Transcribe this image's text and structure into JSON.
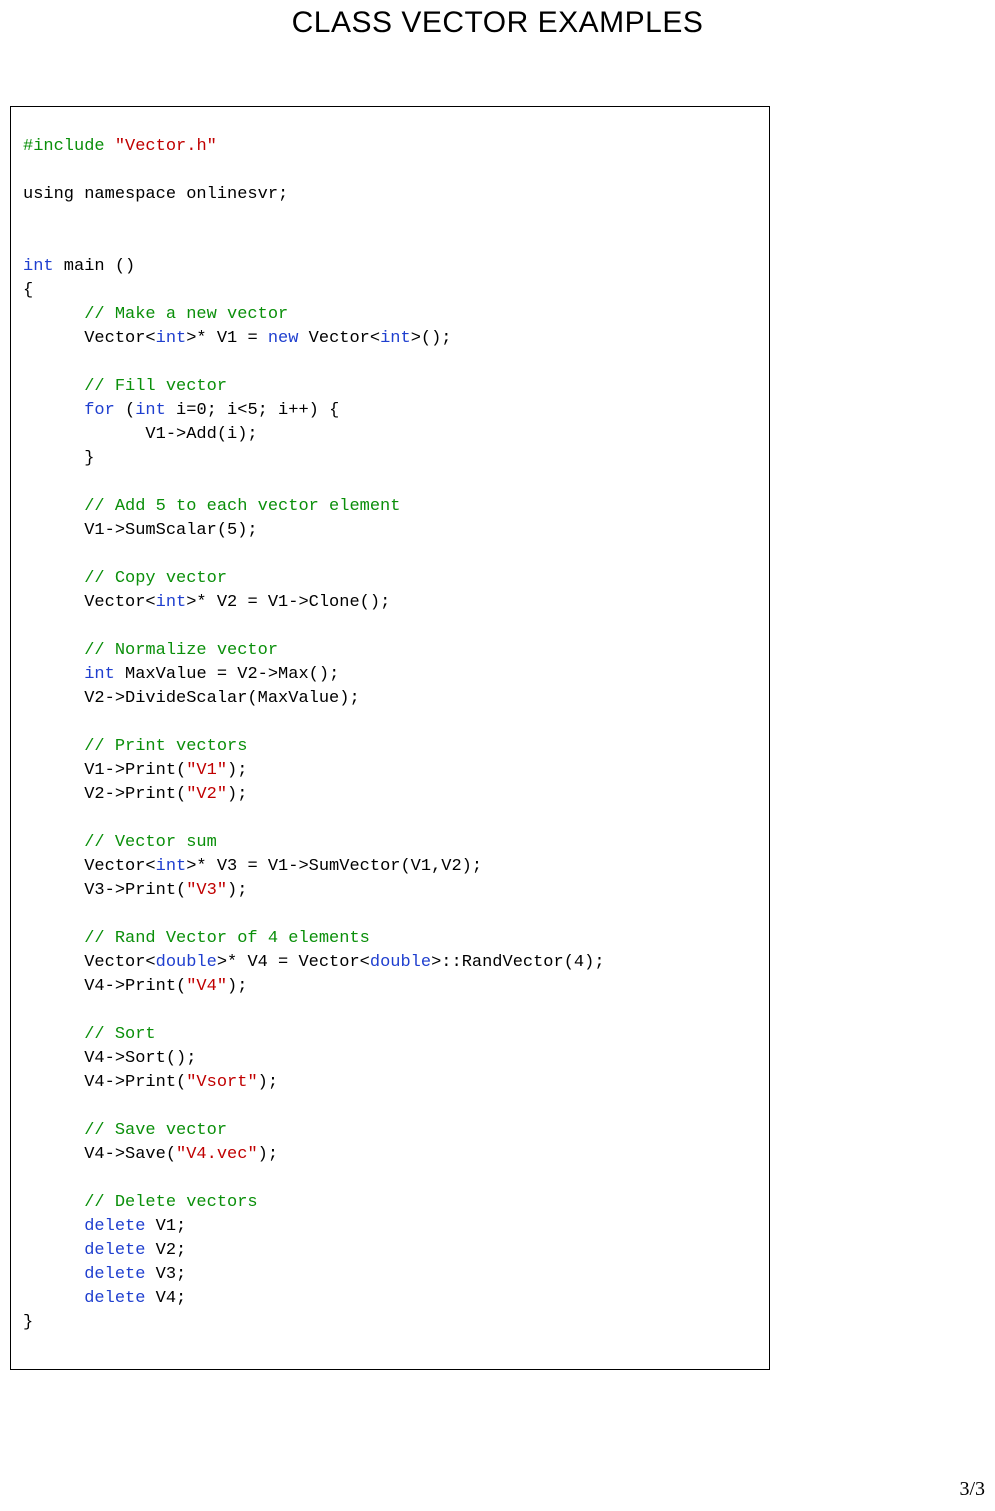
{
  "title": "CLASS VECTOR EXAMPLES",
  "page_number": "3/3",
  "code": {
    "line01_a": "#include",
    "line01_b": "\"Vector.h\"",
    "line02_blank": "",
    "line03": "using namespace onlinesvr;",
    "line04_blank": "",
    "line05_blank": "",
    "line06_a": "int",
    "line06_b": " main ()",
    "line07": "{",
    "line08_cmt": "      // Make a new vector",
    "line09_a": "      Vector<",
    "line09_b": "int",
    "line09_c": ">* V1 = ",
    "line09_d": "new",
    "line09_e": " Vector<",
    "line09_f": "int",
    "line09_g": ">();",
    "line10_blank": "",
    "line11_cmt": "      // Fill vector",
    "line12_a": "      ",
    "line12_b": "for",
    "line12_c": " (",
    "line12_d": "int",
    "line12_e": " i=0; i<5; i++) {",
    "line13": "            V1->Add(i);",
    "line14": "      }",
    "line15_blank": "",
    "line16_cmt": "      // Add 5 to each vector element",
    "line17": "      V1->SumScalar(5);",
    "line18_blank": "",
    "line19_cmt": "      // Copy vector",
    "line20_a": "      Vector<",
    "line20_b": "int",
    "line20_c": ">* V2 = V1->Clone();",
    "line21_blank": "",
    "line22_cmt": "      // Normalize vector",
    "line23_a": "      ",
    "line23_b": "int",
    "line23_c": " MaxValue = V2->Max();",
    "line24": "      V2->DivideScalar(MaxValue);",
    "line25_blank": "",
    "line26_cmt": "      // Print vectors",
    "line27_a": "      V1->Print(",
    "line27_b": "\"V1\"",
    "line27_c": ");",
    "line28_a": "      V2->Print(",
    "line28_b": "\"V2\"",
    "line28_c": ");",
    "line29_blank": "",
    "line30_cmt": "      // Vector sum",
    "line31_a": "      Vector<",
    "line31_b": "int",
    "line31_c": ">* V3 = V1->SumVector(V1,V2);",
    "line32_a": "      V3->Print(",
    "line32_b": "\"V3\"",
    "line32_c": ");",
    "line33_blank": "",
    "line34_cmt": "      // Rand Vector of 4 elements",
    "line35_a": "      Vector<",
    "line35_b": "double",
    "line35_c": ">* V4 = Vector<",
    "line35_d": "double",
    "line35_e": ">::RandVector(4);",
    "line36_a": "      V4->Print(",
    "line36_b": "\"V4\"",
    "line36_c": ");",
    "line37_blank": "",
    "line38_cmt": "      // Sort",
    "line39": "      V4->Sort();",
    "line40_a": "      V4->Print(",
    "line40_b": "\"Vsort\"",
    "line40_c": ");",
    "line41_blank": "",
    "line42_cmt": "      // Save vector",
    "line43_a": "      V4->Save(",
    "line43_b": "\"V4.vec\"",
    "line43_c": ");",
    "line44_blank": "",
    "line45_cmt": "      // Delete vectors",
    "line46_a": "      ",
    "line46_b": "delete",
    "line46_c": " V1;",
    "line47_a": "      ",
    "line47_b": "delete",
    "line47_c": " V2;",
    "line48_a": "      ",
    "line48_b": "delete",
    "line48_c": " V3;",
    "line49_a": "      ",
    "line49_b": "delete",
    "line49_c": " V4;",
    "line50": "}"
  }
}
